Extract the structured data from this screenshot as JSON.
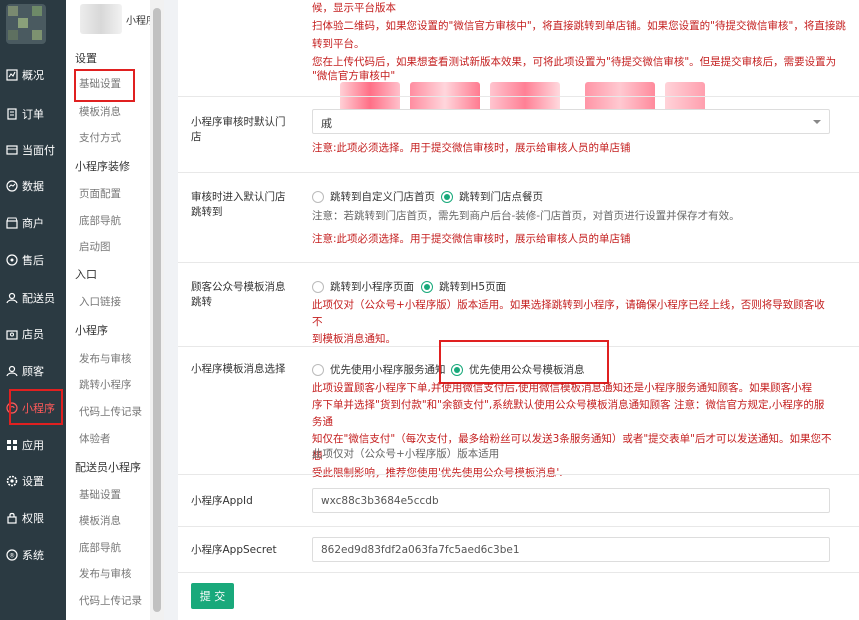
{
  "sidebar": {
    "items": [
      {
        "label": "概况",
        "icon": "overview-icon"
      },
      {
        "label": "订单",
        "icon": "order-icon"
      },
      {
        "label": "当面付",
        "icon": "pay-icon"
      },
      {
        "label": "数据",
        "icon": "data-icon"
      },
      {
        "label": "商户",
        "icon": "merchant-icon"
      },
      {
        "label": "售后",
        "icon": "aftersale-icon"
      },
      {
        "label": "配送员",
        "icon": "courier-icon"
      },
      {
        "label": "店员",
        "icon": "staff-icon"
      },
      {
        "label": "顾客",
        "icon": "customer-icon"
      },
      {
        "label": "小程序",
        "icon": "miniprogram-icon"
      },
      {
        "label": "应用",
        "icon": "apps-icon"
      },
      {
        "label": "设置",
        "icon": "settings-icon"
      },
      {
        "label": "权限",
        "icon": "permission-icon"
      },
      {
        "label": "系统",
        "icon": "system-icon"
      }
    ],
    "active_color": "#ff5a5a"
  },
  "submenu": {
    "header_title": "小程序",
    "groups": [
      {
        "title": "设置",
        "links": [
          "基础设置",
          "模板消息",
          "支付方式"
        ]
      },
      {
        "title": "小程序装修",
        "links": [
          "页面配置",
          "底部导航",
          "启动图"
        ]
      },
      {
        "title": "入口",
        "links": [
          "入口链接"
        ]
      },
      {
        "title": "小程序",
        "links": [
          "发布与审核",
          "跳转小程序",
          "代码上传记录",
          "体验者"
        ]
      },
      {
        "title": "配送员小程序",
        "links": [
          "基础设置",
          "模板消息",
          "底部导航",
          "发布与审核",
          "代码上传记录"
        ]
      }
    ]
  },
  "top_notes": [
    "候，显示平台版本",
    "扫体验二维码，如果您设置的\"微信官方审核中\"，将直接跳转到单店铺。如果您设置的\"待提交微信审核\"，将直接跳",
    "转到平台。",
    "您在上传代码后，如果想查看测试新版本效果，可将此项设置为\"待提交微信审核\"。但是提交审核后，需要设置为",
    "\"微信官方审核中\""
  ],
  "fields": {
    "default_store": {
      "label": "小程序审核时默认门店",
      "select_value": "戚",
      "note": "注意:此项必须选择。用于提交微信审核时，展示给审核人员的单店铺"
    },
    "jump_default": {
      "label": "审核时进入默认门店跳转到",
      "options": [
        "跳转到自定义门店首页",
        "跳转到门店点餐页"
      ],
      "selected": 1,
      "help": "注意：若跳转到门店首页，需先到商户后台-装修-门店首页，对首页进行设置并保存才有效。",
      "note": "注意:此项必须选择。用于提交微信审核时，展示给审核人员的单店铺"
    },
    "template_jump": {
      "label": "顾客公众号模板消息跳转",
      "options": [
        "跳转到小程序页面",
        "跳转到H5页面"
      ],
      "selected": 1,
      "help_lines": [
        "此项仅对（公众号+小程序版）版本适用。如果选择跳转到小程序，请确保小程序已经上线，否则将导致顾客收不",
        "到模板消息通知。"
      ]
    },
    "template_choice": {
      "label": "小程序模板消息选择",
      "options": [
        "优先使用小程序服务通知",
        "优先使用公众号模板消息"
      ],
      "selected": 1,
      "help_lines": [
        "此项设置顾客小程序下单,并使用微信支付后,使用微信模板消息通知还是小程序服务通知顾客。如果顾客小程",
        "序下单并选择\"货到付款\"和\"余额支付\",系统默认使用公众号模板消息通知顾客 注意：微信官方规定,小程序的服务通",
        "知仅在\"微信支付\"（每次支付，最多给粉丝可以发送3条服务通知）或者\"提交表单\"后才可以发送通知。如果您不想",
        "受此限制影响，推荐您使用'优先使用公众号模板消息'."
      ],
      "help_gray": "此项仅对（公众号+小程序版）版本适用"
    },
    "appid": {
      "label": "小程序AppId",
      "value": "wxc88c3b3684e5ccdb"
    },
    "appsecret": {
      "label": "小程序AppSecret",
      "value": "862ed9d83fdf2a063fa7fc5aed6c3be1"
    }
  },
  "submit_label": "提 交",
  "colors": {
    "accent": "#19a97b",
    "warning": "#c41e1e",
    "sidebar_bg": "#2b3a42"
  }
}
